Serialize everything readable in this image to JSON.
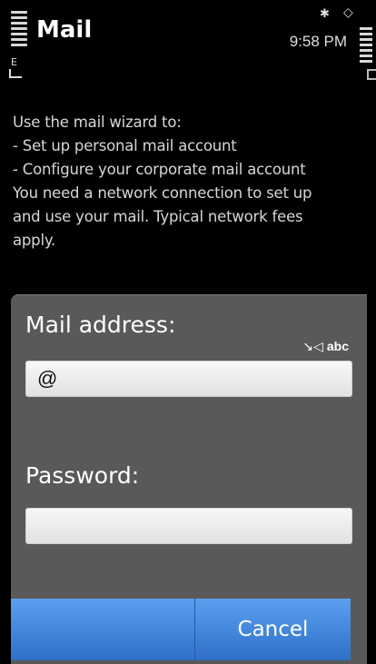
{
  "status": {
    "app_title": "Mail",
    "time": "9:58 PM",
    "network_indicator": "E",
    "icons": [
      "signal-icon",
      "bluetooth-icon",
      "alarm-icon",
      "battery-icon"
    ]
  },
  "wizard": {
    "lines": [
      "Use the mail wizard to:",
      "- Set up personal mail account",
      "- Configure your corporate mail account",
      "You need a network connection to set up",
      "and use your mail. Typical network fees",
      "apply."
    ]
  },
  "dialog": {
    "mail_label": "Mail address:",
    "mail_value": "@",
    "input_mode": "abc",
    "password_label": "Password:",
    "password_value": "",
    "softkey_left": "",
    "softkey_right": "Cancel"
  },
  "colors": {
    "dialog_bg": "#595959",
    "softkey_blue": "#3f82dc"
  }
}
